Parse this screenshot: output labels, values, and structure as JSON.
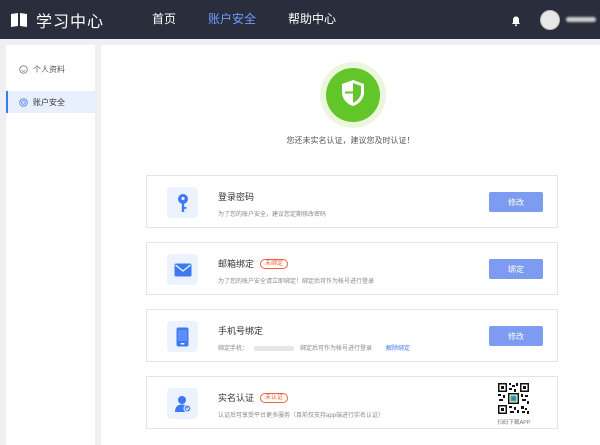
{
  "header": {
    "title": "学习中心",
    "nav": [
      {
        "label": "首页",
        "active": false
      },
      {
        "label": "账户安全",
        "active": true
      },
      {
        "label": "帮助中心",
        "active": false
      }
    ]
  },
  "sidebar": {
    "items": [
      {
        "label": "个人资料",
        "icon": "smile-icon",
        "active": false
      },
      {
        "label": "账户安全",
        "icon": "target-icon",
        "active": true
      }
    ]
  },
  "main": {
    "notice": "您还未实名认证，建议您及时认证！",
    "cards": [
      {
        "title": "登录密码",
        "desc": "为了您的账户安全，建议您定期修改密码",
        "button": "修改",
        "icon": "key-icon"
      },
      {
        "title": "邮箱绑定",
        "badge": "未绑定",
        "desc": "为了您的账户安全请立即绑定！绑定后可作为帐号进行登录",
        "button": "绑定",
        "icon": "mail-icon"
      },
      {
        "title": "手机号绑定",
        "desc_prefix": "绑定手机：",
        "desc_suffix": "绑定后可作为帐号进行登录",
        "link": "解除绑定",
        "button": "修改",
        "icon": "phone-icon"
      },
      {
        "title": "实名认证",
        "badge": "未认证",
        "desc": "认证后可享受平台更多服务（目前仅支持app端进行实名认证）",
        "qr_caption": "扫码下载APP",
        "icon": "user-verified-icon"
      }
    ]
  },
  "colors": {
    "header_bg": "#2a2d3b",
    "nav_active": "#6e9bff",
    "accent": "#3d79f2",
    "button": "#7d9cf1",
    "shield": "#62c52a",
    "badge": "#f0603c"
  }
}
